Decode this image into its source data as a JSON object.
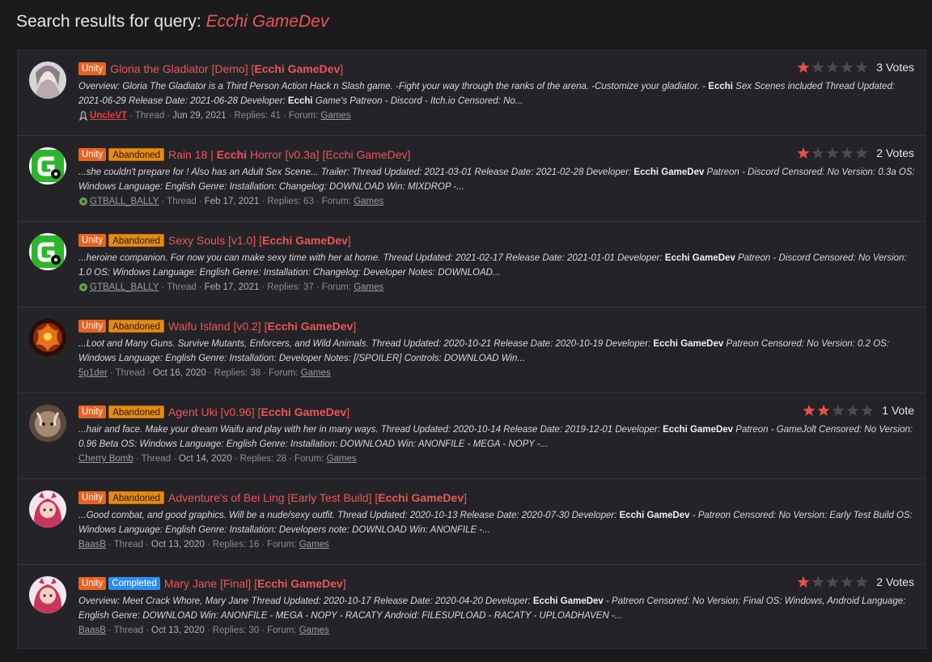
{
  "page": {
    "title_prefix": "Search results for query: ",
    "query": "Ecchi GameDev"
  },
  "colors": {
    "accent": "#ec5555",
    "engine_badge": "#e9621f",
    "abandoned_badge": "#e78a12",
    "completed_badge": "#2d8cf0",
    "star_on": "#e8524a",
    "star_off": "#4a4a50"
  },
  "results": [
    {
      "engine": "Unity",
      "status": "",
      "title": "Gloria the Gladiator [Demo] [",
      "title_hl": "Ecchi GameDev",
      "title_end": "]",
      "snippet_parts": [
        "Overview: Gloria The Gladiator is a Third Person Action Hack n Slash game. -Fight your way through the ranks of the arena. -Customize your gladiator. - ",
        "Ecchi",
        " Sex Scenes included Thread Updated: 2021-06-29 Release Date: 2021-06-28 Developer: ",
        "Ecchi",
        " Game's Patreon - Discord - Itch.io Censored: No..."
      ],
      "user": "UncleVT",
      "type": "Thread",
      "date": "Jun 29, 2021",
      "replies": "Replies: 41",
      "forum_label": "Forum:",
      "forum": "Games",
      "rating": 1,
      "votes": "3 Votes",
      "avatar": "anime-girl-avatar"
    },
    {
      "engine": "Unity",
      "status": "Abandoned",
      "title": "Rain 18 | ",
      "title_hl": "Ecchi",
      "title_end": " Horror [v0.3a] [Ecchi GameDev]",
      "snippet_parts": [
        "...she couldn't prepare for ! Also has an Adult Sex Scene... Trailer: Thread Updated: 2021-03-01 Release Date: 2021-02-28 Developer: ",
        "Ecchi GameDev",
        " Patreon - Discord Censored: No Version: 0.3a OS: Windows Language: English Genre: Installation: Changelog: DOWNLOAD Win: MIXDROP -...",
        "",
        ""
      ],
      "user": "GTBALL_BALLY",
      "type": "Thread",
      "date": "Feb 17, 2021",
      "replies": "Replies: 63",
      "forum_label": "Forum:",
      "forum": "Games",
      "rating": 1,
      "votes": "2 Votes",
      "avatar": "green-g-avatar"
    },
    {
      "engine": "Unity",
      "status": "Abandoned",
      "title": "Sexy Souls [v1.0] [",
      "title_hl": "Ecchi GameDev",
      "title_end": "]",
      "snippet_parts": [
        "...heroine companion. For now you can make sexy time with her at home. Thread Updated: 2021-02-17 Release Date: 2021-01-01 Developer: ",
        "Ecchi GameDev",
        " Patreon - Discord Censored: No Version: 1.0 OS: Windows Language: English Genre: Installation: Changelog: Developer Notes: DOWNLOAD...",
        "",
        ""
      ],
      "user": "GTBALL_BALLY",
      "type": "Thread",
      "date": "Feb 17, 2021",
      "replies": "Replies: 37",
      "forum_label": "Forum:",
      "forum": "Games",
      "rating": 0,
      "votes": "",
      "avatar": "green-g-avatar"
    },
    {
      "engine": "Unity",
      "status": "Abandoned",
      "title": "Waifu Island [v0.2] [",
      "title_hl": "Ecchi GameDev",
      "title_end": "]",
      "snippet_parts": [
        "...Loot and Many Guns. Survive Mutants, Enforcers, and Wild Animals. Thread Updated: 2020-10-21 Release Date: 2020-10-19 Developer: ",
        "Ecchi GameDev",
        " Patreon Censored: No Version: 0.2 OS: Windows Language: English Genre: Installation: Developer Notes: [/SPOILER] Controls: DOWNLOAD Win...",
        "",
        ""
      ],
      "user": "5p1der",
      "type": "Thread",
      "date": "Oct 16, 2020",
      "replies": "Replies: 38",
      "forum_label": "Forum:",
      "forum": "Games",
      "rating": 0,
      "votes": "",
      "avatar": "fire-avatar"
    },
    {
      "engine": "Unity",
      "status": "Abandoned",
      "title": "Agent Uki [v0.96] [",
      "title_hl": "Ecchi GameDev",
      "title_end": "]",
      "snippet_parts": [
        "...hair and face. Make your dream Waifu and play with her in many ways. Thread Updated: 2020-10-14 Release Date: 2019-12-01 Developer: ",
        "Ecchi GameDev",
        " Patreon - GameJolt Censored: No Version: 0.96 Beta OS: Windows Language: English Genre: Installation: DOWNLOAD Win: ANONFILE - MEGA - NOPY -...",
        "",
        ""
      ],
      "user": "Cherry Bomb",
      "type": "Thread",
      "date": "Oct 14, 2020",
      "replies": "Replies: 28",
      "forum_label": "Forum:",
      "forum": "Games",
      "rating": 2,
      "votes": "1 Vote",
      "avatar": "creature-avatar"
    },
    {
      "engine": "Unity",
      "status": "Abandoned",
      "title": "Adventure's of Bei Ling [Early Test Build] [",
      "title_hl": "Ecchi GameDev",
      "title_end": "]",
      "snippet_parts": [
        "...Good combat, and good graphics. Will be a nude/sexy outfit. Thread Updated: 2020-10-13 Release Date: 2020-07-30 Developer: ",
        "Ecchi GameDev",
        " - Patreon Censored: No Version: Early Test Build OS: Windows Language: English Genre: Installation: Developers note: DOWNLOAD Win: ANONFILE -...",
        "",
        ""
      ],
      "user": "BaasB",
      "type": "Thread",
      "date": "Oct 13, 2020",
      "replies": "Replies: 16",
      "forum_label": "Forum:",
      "forum": "Games",
      "rating": 0,
      "votes": "",
      "avatar": "pink-hair-avatar"
    },
    {
      "engine": "Unity",
      "status": "Completed",
      "title": "Mary Jane [Final] [",
      "title_hl": "Ecchi GameDev",
      "title_end": "]",
      "snippet_parts": [
        "Overview: Meet Crack Whore, Mary Jane Thread Updated: 2020-10-17 Release Date: 2020-04-20 Developer: ",
        "Ecchi GameDev",
        " - Patreon Censored: No Version: Final OS: Windows, Android Language: English Genre: DOWNLOAD Win: ANONFILE - MEGA - NOPY - RACATY Android: FILESUPLOAD - RACATY - UPLOADHAVEN -...",
        "",
        ""
      ],
      "user": "BaasB",
      "type": "Thread",
      "date": "Oct 13, 2020",
      "replies": "Replies: 30",
      "forum_label": "Forum:",
      "forum": "Games",
      "rating": 1,
      "votes": "2 Votes",
      "avatar": "pink-hair-avatar"
    }
  ]
}
